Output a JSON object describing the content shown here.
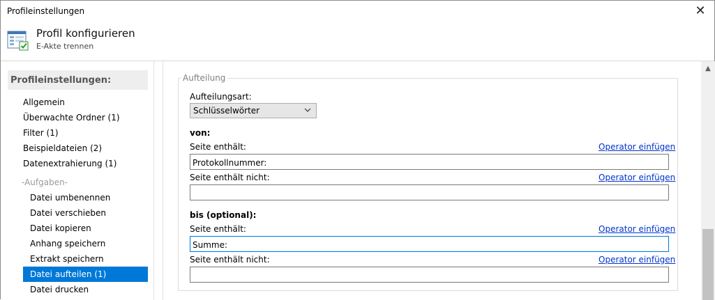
{
  "window": {
    "title": "Profileinstellungen",
    "close_icon": "close-icon"
  },
  "header": {
    "title": "Profil konfigurieren",
    "subtitle": "E-Akte trennen",
    "icon": "profile-settings-icon"
  },
  "sidebar": {
    "heading": "Profileinstellungen:",
    "items": [
      {
        "label": "Allgemein"
      },
      {
        "label": "Überwachte Ordner (1)"
      },
      {
        "label": "Filter (1)"
      },
      {
        "label": "Beispieldateien (2)"
      },
      {
        "label": "Datenextrahierung (1)"
      }
    ],
    "group_label": "-Aufgaben-",
    "tasks": [
      {
        "label": "Datei umbenennen"
      },
      {
        "label": "Datei verschieben"
      },
      {
        "label": "Datei kopieren"
      },
      {
        "label": "Anhang speichern"
      },
      {
        "label": "Extrakt speichern"
      },
      {
        "label": "Datei aufteilen (1)",
        "selected": true
      },
      {
        "label": "Datei drucken"
      }
    ]
  },
  "main": {
    "group_title": "Aufteilung",
    "split_type_label": "Aufteilungsart:",
    "split_type_value": "Schlüsselwörter",
    "from": {
      "heading": "von:",
      "contains_label": "Seite enthält:",
      "contains_value": "Protokollnummer:",
      "not_contains_label": "Seite enthält nicht:",
      "not_contains_value": ""
    },
    "to": {
      "heading": "bis (optional):",
      "contains_label": "Seite enthält:",
      "contains_value": "Summe:",
      "not_contains_label": "Seite enthält nicht:",
      "not_contains_value": ""
    },
    "insert_operator_label": "Operator einfügen"
  },
  "colors": {
    "accent": "#0078d7",
    "link": "#0033cc",
    "sidebar_heading_bg": "#eeeeee"
  }
}
